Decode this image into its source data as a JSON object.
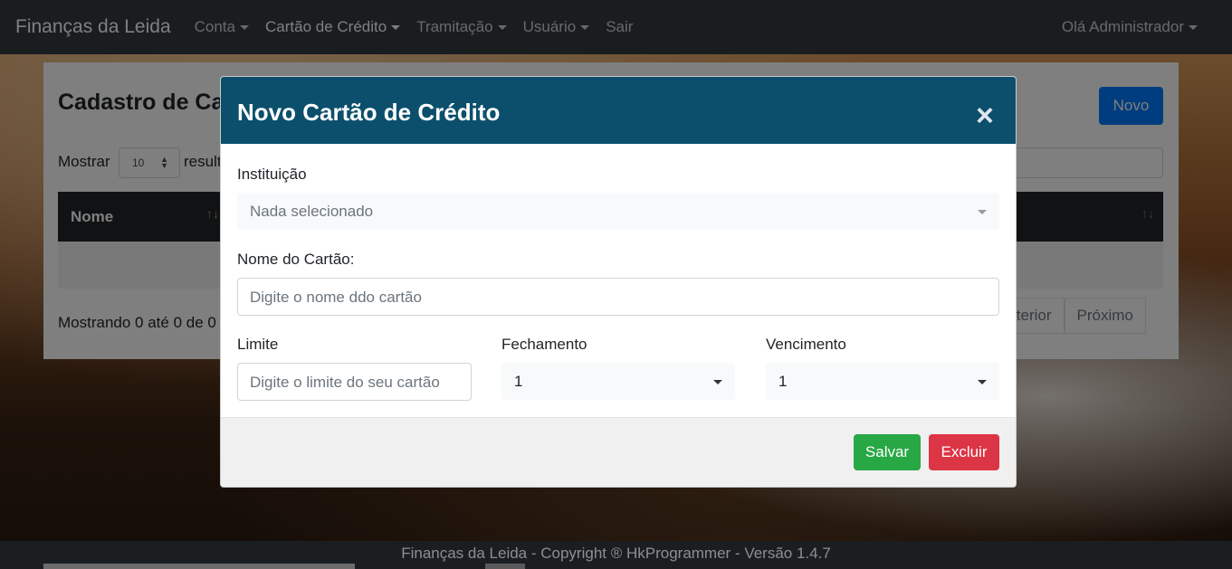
{
  "navbar": {
    "brand": "Finanças da Leida",
    "items": [
      {
        "label": "Conta",
        "dropdown": true
      },
      {
        "label": "Cartão de Crédito",
        "dropdown": true
      },
      {
        "label": "Tramitação",
        "dropdown": true
      },
      {
        "label": "Usuário",
        "dropdown": true
      },
      {
        "label": "Sair",
        "dropdown": false
      }
    ],
    "user_greeting": "Olá Administrador"
  },
  "page": {
    "title": "Cadastro de Ca",
    "new_button": "Novo",
    "show_label": "Mostrar",
    "show_value": "10",
    "show_suffix": "result",
    "columns": [
      "Nome"
    ],
    "info": "Mostrando 0 até 0 de 0",
    "pager": [
      "Anterior",
      "Próximo"
    ]
  },
  "modal": {
    "title": "Novo Cartão de Crédito",
    "close_icon": "×",
    "institution_label": "Instituição",
    "institution_placeholder": "Nada selecionado",
    "card_name_label": "Nome do Cartão:",
    "card_name_placeholder": "Digite o nome ddo cartão",
    "limit_label": "Limite",
    "limit_placeholder": "Digite o limite do seu cartão",
    "closing_label": "Fechamento",
    "closing_value": "1",
    "due_label": "Vencimento",
    "due_value": "1",
    "save_button": "Salvar",
    "delete_button": "Excluir"
  },
  "footer": {
    "text": "Finanças da Leida - Copyright ® HkProgrammer - Versão 1.4.7"
  },
  "colors": {
    "navbar": "#343a40",
    "modal_header": "#0b4f6c",
    "save": "#28a745",
    "delete": "#dc3545",
    "primary": "#007bff"
  }
}
